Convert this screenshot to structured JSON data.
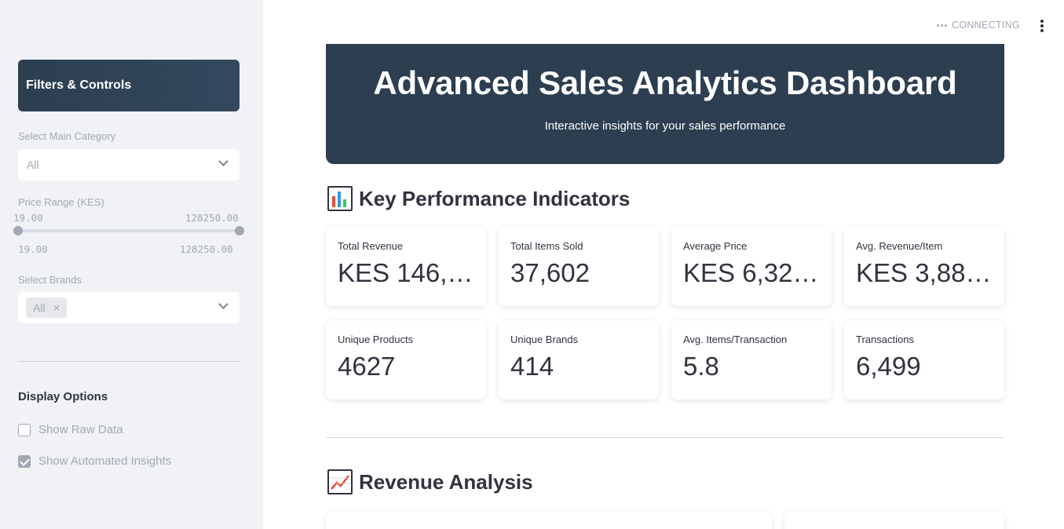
{
  "sidebar": {
    "title": "Filters & Controls",
    "main_category": {
      "label": "Select Main Category",
      "value": "All"
    },
    "price_range": {
      "label": "Price Range (KES)",
      "min_label": "19.00",
      "max_label": "128250.00",
      "min_value": "19.00",
      "max_value": "128250.00"
    },
    "brands": {
      "label": "Select Brands",
      "tag": "All",
      "tag_remove": "×"
    },
    "display_options": {
      "heading": "Display Options",
      "show_raw_data": {
        "label": "Show Raw Data",
        "checked": false
      },
      "show_insights": {
        "label": "Show Automated Insights",
        "checked": true
      }
    }
  },
  "topbar": {
    "status": "CONNECTING"
  },
  "header": {
    "title": "Advanced Sales Analytics Dashboard",
    "subtitle": "Interactive insights for your sales performance"
  },
  "kpi_section": {
    "heading": "Key Performance Indicators",
    "cards": [
      {
        "label": "Total Revenue",
        "value": "KES 146,…"
      },
      {
        "label": "Total Items Sold",
        "value": "37,602"
      },
      {
        "label": "Average Price",
        "value": "KES 6,32…"
      },
      {
        "label": "Avg. Revenue/Item",
        "value": "KES 3,88…"
      },
      {
        "label": "Unique Products",
        "value": "4627"
      },
      {
        "label": "Unique Brands",
        "value": "414"
      },
      {
        "label": "Avg. Items/Transaction",
        "value": "5.8"
      },
      {
        "label": "Transactions",
        "value": "6,499"
      }
    ]
  },
  "revenue_section": {
    "heading": "Revenue Analysis"
  },
  "colors": {
    "header_bg": "#2c3e50",
    "sidebar_bg": "#f0f2f6",
    "muted": "#a3a8b4"
  }
}
